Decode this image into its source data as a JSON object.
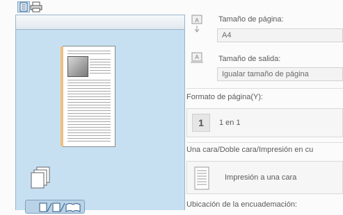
{
  "preview": {
    "toolbar_icons": [
      "page-view-icon",
      "printer-view-icon"
    ],
    "layout_icons": [
      "page-layout-icon",
      "booklet-icon"
    ]
  },
  "settings": {
    "page_size": {
      "label": "Tamaño de página:",
      "value": "A4"
    },
    "output_size": {
      "label": "Tamaño de salida:",
      "value": "Igualar tamaño de página"
    },
    "page_format": {
      "label": "Formato de página(Y):",
      "icon_text": "1",
      "value": "1 en 1"
    },
    "duplex": {
      "label": "Una cara/Doble cara/Impresión en cu",
      "value": "Impresión a una cara"
    },
    "binding_location": {
      "label": "Ubicación de la encuademación:"
    }
  },
  "colors": {
    "panel_bg": "#c7e0f1",
    "binding": "#f0c080",
    "accent": "#7ea5c6"
  }
}
